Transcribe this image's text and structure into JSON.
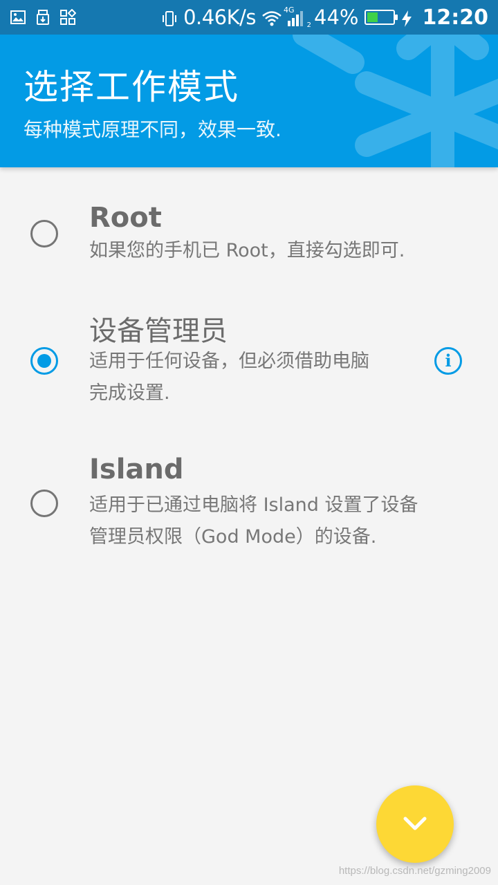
{
  "status_bar": {
    "net_speed": "0.46K/s",
    "network_type": "4G",
    "sim_slot": "2",
    "battery_percent": "44%",
    "battery_level": 0.44,
    "time": "12:20",
    "left_icons": [
      "image-icon",
      "usb-icon",
      "app-grid-icon"
    ]
  },
  "header": {
    "title": "选择工作模式",
    "subtitle": "每种模式原理不同，效果一致."
  },
  "options": [
    {
      "id": "root",
      "title": "Root",
      "description": "如果您的手机已 Root，直接勾选即可.",
      "selected": false
    },
    {
      "id": "device-admin",
      "title": "设备管理员",
      "description_lines": [
        "适用于任何设备，但必须借助电脑",
        "完成设置."
      ],
      "selected": true,
      "info_icon": "info-icon"
    },
    {
      "id": "island",
      "title": "Island",
      "description_lines": [
        "适用于已通过电脑将 Island 设置了设备",
        "管理员权限（God Mode）的设备."
      ],
      "selected": false
    }
  ],
  "fab": {
    "icon": "chevron-down-icon"
  },
  "watermark": "https://blog.csdn.net/gzming2009",
  "colors": {
    "primary": "#039be5",
    "status_bar": "#1578b0",
    "fab": "#fdd835",
    "background": "#f4f4f4"
  }
}
